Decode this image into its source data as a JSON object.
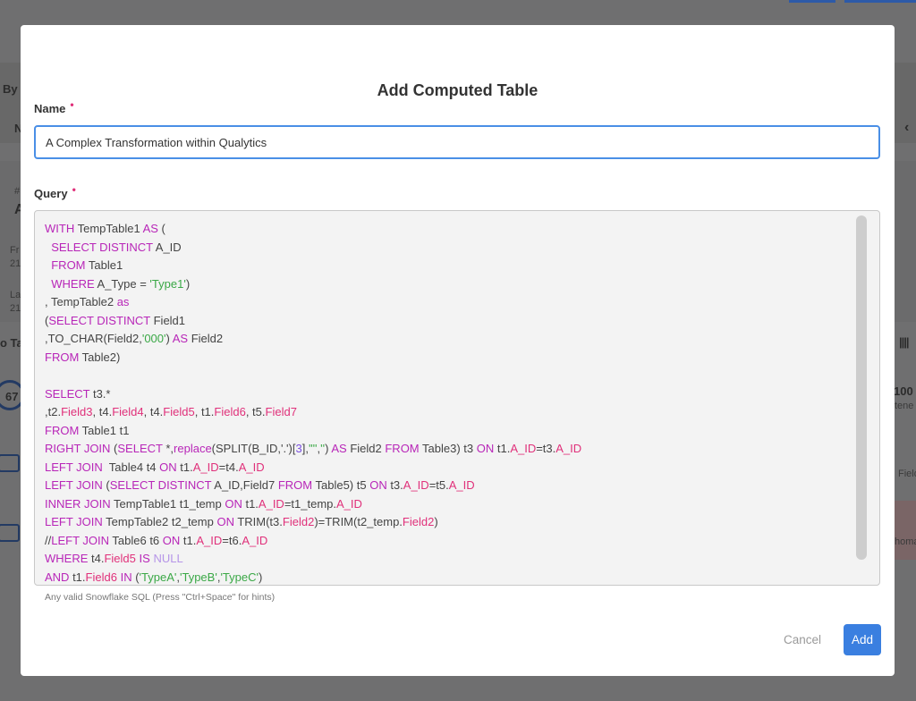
{
  "background": {
    "fragments": [
      "By",
      "N",
      "#",
      "A",
      "Fr",
      "21",
      "La",
      "21",
      "o Ta",
      "67",
      "100",
      "tene",
      "Field",
      "homa"
    ]
  },
  "modal": {
    "title": "Add Computed Table",
    "name_label": "Name",
    "name_value": "A Complex Transformation within Qualytics",
    "query_label": "Query",
    "required_marker": "•",
    "hint": "Any valid Snowflake SQL (Press \"Ctrl+Space\" for hints)",
    "cancel_label": "Cancel",
    "add_label": "Add"
  },
  "colors": {
    "keyword": "#b826b8",
    "field": "#e0307a",
    "string": "#3aa846",
    "number": "#7a4fe0",
    "plain": "#444444",
    "null": "#b695e8",
    "accent": "#3a7fe0"
  },
  "query_lines": [
    [
      [
        "k",
        "WITH"
      ],
      [
        "p",
        " TempTable1 "
      ],
      [
        "k",
        "AS"
      ],
      [
        "p",
        " ("
      ]
    ],
    [
      [
        "p",
        "  "
      ],
      [
        "k",
        "SELECT DISTINCT"
      ],
      [
        "p",
        " A_ID"
      ]
    ],
    [
      [
        "p",
        "  "
      ],
      [
        "k",
        "FROM"
      ],
      [
        "p",
        " Table1"
      ]
    ],
    [
      [
        "p",
        "  "
      ],
      [
        "k",
        "WHERE"
      ],
      [
        "p",
        " A_Type = "
      ],
      [
        "s",
        "'Type1'"
      ],
      [
        "p",
        ")"
      ]
    ],
    [
      [
        "p",
        ", TempTable2 "
      ],
      [
        "k",
        "as"
      ]
    ],
    [
      [
        "p",
        "("
      ],
      [
        "k",
        "SELECT DISTINCT"
      ],
      [
        "p",
        " Field1"
      ]
    ],
    [
      [
        "p",
        ",TO_CHAR(Field2,"
      ],
      [
        "s",
        "'000'"
      ],
      [
        "p",
        ") "
      ],
      [
        "k",
        "AS"
      ],
      [
        "p",
        " Field2"
      ]
    ],
    [
      [
        "k",
        "FROM"
      ],
      [
        "p",
        " Table2)"
      ]
    ],
    [],
    [
      [
        "k",
        "SELECT"
      ],
      [
        "p",
        " t3.*"
      ]
    ],
    [
      [
        "p",
        ",t2."
      ],
      [
        "f",
        "Field3"
      ],
      [
        "p",
        ", t4."
      ],
      [
        "f",
        "Field4"
      ],
      [
        "p",
        ", t4."
      ],
      [
        "f",
        "Field5"
      ],
      [
        "p",
        ", t1."
      ],
      [
        "f",
        "Field6"
      ],
      [
        "p",
        ", t5."
      ],
      [
        "f",
        "Field7"
      ]
    ],
    [
      [
        "k",
        "FROM"
      ],
      [
        "p",
        " Table1 t1"
      ]
    ],
    [
      [
        "k",
        "RIGHT JOIN"
      ],
      [
        "p",
        " ("
      ],
      [
        "k",
        "SELECT"
      ],
      [
        "p",
        " *,"
      ],
      [
        "k",
        "replace"
      ],
      [
        "p",
        "(SPLIT(B_ID,'.')["
      ],
      [
        "n",
        "3"
      ],
      [
        "p",
        "],"
      ],
      [
        "s",
        "'\"'"
      ],
      [
        "p",
        ","
      ],
      [
        "s",
        "''"
      ],
      [
        "p",
        ") "
      ],
      [
        "k",
        "AS"
      ],
      [
        "p",
        " Field2 "
      ],
      [
        "k",
        "FROM"
      ],
      [
        "p",
        " Table3) t3 "
      ],
      [
        "k",
        "ON"
      ],
      [
        "p",
        " t1."
      ],
      [
        "f",
        "A_ID"
      ],
      [
        "p",
        "=t3."
      ],
      [
        "f",
        "A_ID"
      ]
    ],
    [
      [
        "k",
        "LEFT JOIN"
      ],
      [
        "p",
        "  Table4 t4 "
      ],
      [
        "k",
        "ON"
      ],
      [
        "p",
        " t1."
      ],
      [
        "f",
        "A_ID"
      ],
      [
        "p",
        "=t4."
      ],
      [
        "f",
        "A_ID"
      ]
    ],
    [
      [
        "k",
        "LEFT JOIN"
      ],
      [
        "p",
        " ("
      ],
      [
        "k",
        "SELECT DISTINCT"
      ],
      [
        "p",
        " A_ID,Field7 "
      ],
      [
        "k",
        "FROM"
      ],
      [
        "p",
        " Table5) t5 "
      ],
      [
        "k",
        "ON"
      ],
      [
        "p",
        " t3."
      ],
      [
        "f",
        "A_ID"
      ],
      [
        "p",
        "=t5."
      ],
      [
        "f",
        "A_ID"
      ]
    ],
    [
      [
        "k",
        "INNER JOIN"
      ],
      [
        "p",
        " TempTable1 t1_temp "
      ],
      [
        "k",
        "ON"
      ],
      [
        "p",
        " t1."
      ],
      [
        "f",
        "A_ID"
      ],
      [
        "p",
        "=t1_temp."
      ],
      [
        "f",
        "A_ID"
      ]
    ],
    [
      [
        "k",
        "LEFT JOIN"
      ],
      [
        "p",
        " TempTable2 t2_temp "
      ],
      [
        "k",
        "ON"
      ],
      [
        "p",
        " TRIM(t3."
      ],
      [
        "f",
        "Field2"
      ],
      [
        "p",
        ")=TRIM(t2_temp."
      ],
      [
        "f",
        "Field2"
      ],
      [
        "p",
        ")"
      ]
    ],
    [
      [
        "p",
        "//"
      ],
      [
        "k",
        "LEFT JOIN"
      ],
      [
        "p",
        " Table6 t6 "
      ],
      [
        "k",
        "ON"
      ],
      [
        "p",
        " t1."
      ],
      [
        "f",
        "A_ID"
      ],
      [
        "p",
        "=t6."
      ],
      [
        "f",
        "A_ID"
      ]
    ],
    [
      [
        "k",
        "WHERE"
      ],
      [
        "p",
        " t4."
      ],
      [
        "f",
        "Field5"
      ],
      [
        "p",
        " "
      ],
      [
        "k",
        "IS"
      ],
      [
        "p",
        " "
      ],
      [
        "u",
        "NULL"
      ]
    ],
    [
      [
        "k",
        "AND"
      ],
      [
        "p",
        " t1."
      ],
      [
        "f",
        "Field6"
      ],
      [
        "p",
        " "
      ],
      [
        "k",
        "IN"
      ],
      [
        "p",
        " ("
      ],
      [
        "s",
        "'TypeA'"
      ],
      [
        "p",
        ","
      ],
      [
        "s",
        "'TypeB'"
      ],
      [
        "p",
        ","
      ],
      [
        "s",
        "'TypeC'"
      ],
      [
        "p",
        ")"
      ]
    ]
  ]
}
